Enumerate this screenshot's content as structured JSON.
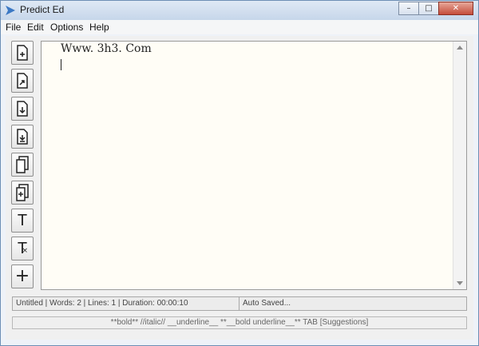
{
  "window": {
    "title": "Predict Ed"
  },
  "menu": {
    "items": [
      "File",
      "Edit",
      "Options",
      "Help"
    ]
  },
  "window_controls": {
    "minimize": "–",
    "maximize": "□",
    "close": "✕"
  },
  "toolbar": {
    "buttons": [
      {
        "icon": "new-document-icon"
      },
      {
        "icon": "open-document-icon"
      },
      {
        "icon": "save-document-icon"
      },
      {
        "icon": "save-as-document-icon"
      },
      {
        "icon": "copy-document-icon"
      },
      {
        "icon": "add-document-icon"
      },
      {
        "icon": "text-format-icon",
        "glyph": "T"
      },
      {
        "icon": "clear-format-icon",
        "glyph": "T"
      },
      {
        "icon": "plus-icon",
        "glyph": "+"
      }
    ]
  },
  "editor": {
    "content": "Www. 3h3. Com"
  },
  "status": {
    "left": "Untitled | Words: 2 | Lines: 1 | Duration: 00:00:10",
    "right": "Auto Saved..."
  },
  "hint_bar": {
    "text": "**bold**   //italic//   __underline__   **__bold underline__**   TAB [Suggestions]"
  }
}
